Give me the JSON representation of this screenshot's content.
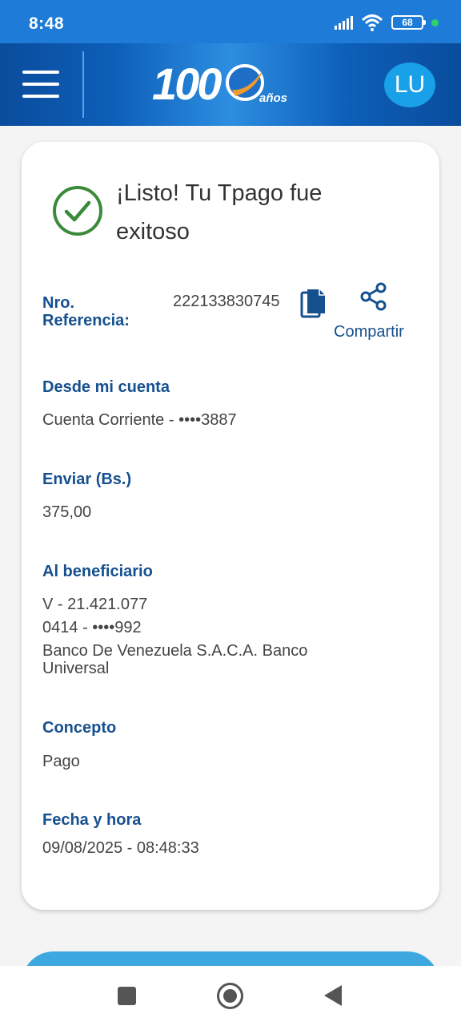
{
  "status_bar": {
    "time": "8:48",
    "battery": "68"
  },
  "header": {
    "logo_number": "100",
    "logo_suffix": "años",
    "avatar_initials": "LU"
  },
  "receipt": {
    "title": "¡Listo! Tu Tpago fue exitoso",
    "reference_label": "Nro. Referencia:",
    "reference_value": "222133830745",
    "share_label": "Compartir",
    "from_label": "Desde mi cuenta",
    "from_value": "Cuenta Corriente - ••••3887",
    "amount_label": "Enviar (Bs.)",
    "amount_value": "375,00",
    "beneficiary_label": "Al beneficiario",
    "beneficiary_id": "V - 21.421.077",
    "beneficiary_phone": "0414 - ••••992",
    "beneficiary_bank": "Banco De Venezuela S.A.C.A. Banco Universal",
    "concept_label": "Concepto",
    "concept_value": "Pago",
    "datetime_label": "Fecha y hora",
    "datetime_value": "09/08/2025 - 08:48:33"
  },
  "colors": {
    "accent": "#16508f",
    "success": "#3a8a3a",
    "header": "#0d5fb8"
  }
}
